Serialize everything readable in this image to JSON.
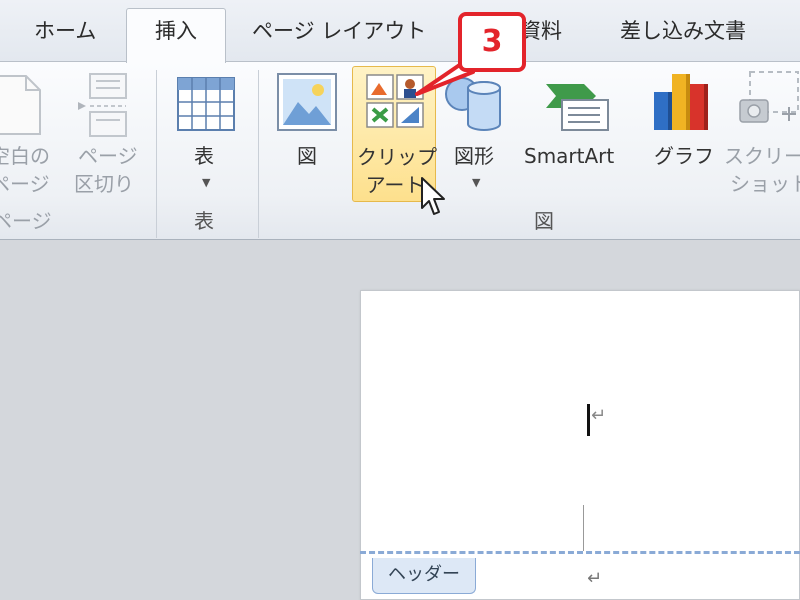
{
  "tabs": {
    "home": "ホーム",
    "insert": "挿入",
    "page_layout": "ページ レイアウト",
    "references_partial": "資料",
    "mailings": "差し込み文書"
  },
  "ribbon": {
    "pages_group": {
      "blank_page_line1": "空白の",
      "blank_page_line2": "ページ",
      "page_break_line1": "ページ",
      "page_break_line2": "区切り",
      "label": "ページ"
    },
    "table_group": {
      "table_button": "表",
      "label": "表"
    },
    "illustrations_group": {
      "picture_button": "図",
      "clipart_line1": "クリップ",
      "clipart_line2": "アート",
      "shapes_button": "図形",
      "smartart_button": "SmartArt",
      "chart_button": "グラフ",
      "screenshot_line1": "スクリー",
      "screenshot_line2": "ショット",
      "label": "図"
    }
  },
  "callout": {
    "step_number": "3",
    "color": "#e3242b"
  },
  "document": {
    "header_tag": "ヘッダー",
    "paragraph_mark": "↵",
    "return_mark": "↵"
  },
  "colors": {
    "highlight": "#fde08d",
    "header_line": "#8aaad6"
  }
}
